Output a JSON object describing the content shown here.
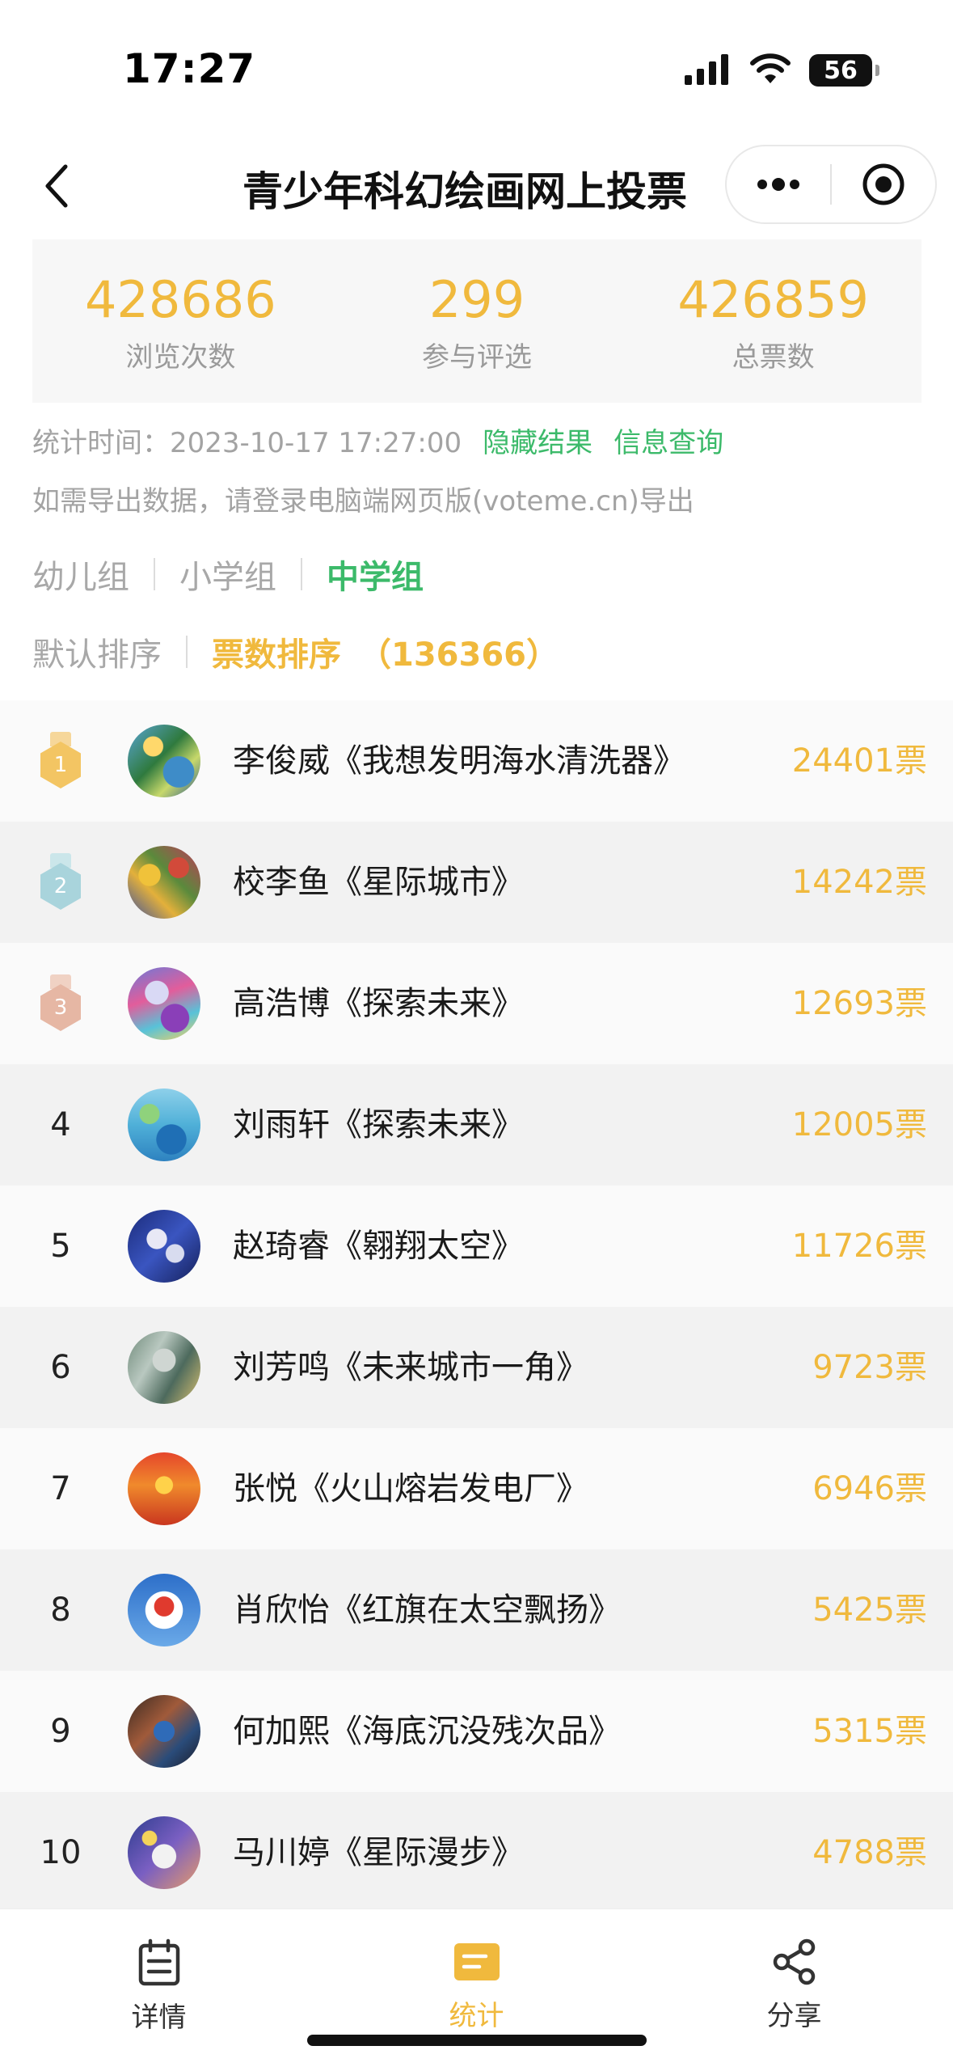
{
  "status": {
    "time": "17:27",
    "battery": "56"
  },
  "nav": {
    "title": "青少年科幻绘画网上投票"
  },
  "stats": [
    {
      "value": "428686",
      "label": "浏览次数"
    },
    {
      "value": "299",
      "label": "参与评选"
    },
    {
      "value": "426859",
      "label": "总票数"
    }
  ],
  "info": {
    "stat_time": "统计时间：2023-10-17 17:27:00",
    "hide_results": "隐藏结果",
    "info_query": "信息查询",
    "export_note": "如需导出数据，请登录电脑端网页版(voteme.cn)导出"
  },
  "group_tabs": [
    "幼儿组",
    "小学组",
    "中学组"
  ],
  "sort_tabs": {
    "default": "默认排序",
    "by_votes": "票数排序",
    "total": "（136366）"
  },
  "entries": [
    {
      "rank": "1",
      "name": "李俊威《我想发明海水清洗器》",
      "votes": "24401票"
    },
    {
      "rank": "2",
      "name": "校李鱼《星际城市》",
      "votes": "14242票"
    },
    {
      "rank": "3",
      "name": "高浩博《探索未来》",
      "votes": "12693票"
    },
    {
      "rank": "4",
      "name": "刘雨轩《探索未来》",
      "votes": "12005票"
    },
    {
      "rank": "5",
      "name": "赵琦睿《翱翔太空》",
      "votes": "11726票"
    },
    {
      "rank": "6",
      "name": "刘芳鸣《未来城市一角》",
      "votes": "9723票"
    },
    {
      "rank": "7",
      "name": "张悦《火山熔岩发电厂》",
      "votes": "6946票"
    },
    {
      "rank": "8",
      "name": "肖欣怡《红旗在太空飘扬》",
      "votes": "5425票"
    },
    {
      "rank": "9",
      "name": "何加熙《海底沉没残次品》",
      "votes": "5315票"
    },
    {
      "rank": "10",
      "name": "马川婷《星际漫步》",
      "votes": "4788票"
    }
  ],
  "tabbar": {
    "details": "详情",
    "stats": "统计",
    "share": "分享"
  },
  "colors": {
    "accent_gold": "#f0b93d",
    "accent_green": "#3cba6a",
    "medal_gold": "#f3c563",
    "medal_silver": "#a9d4dc",
    "medal_bronze": "#e6b7a4"
  }
}
